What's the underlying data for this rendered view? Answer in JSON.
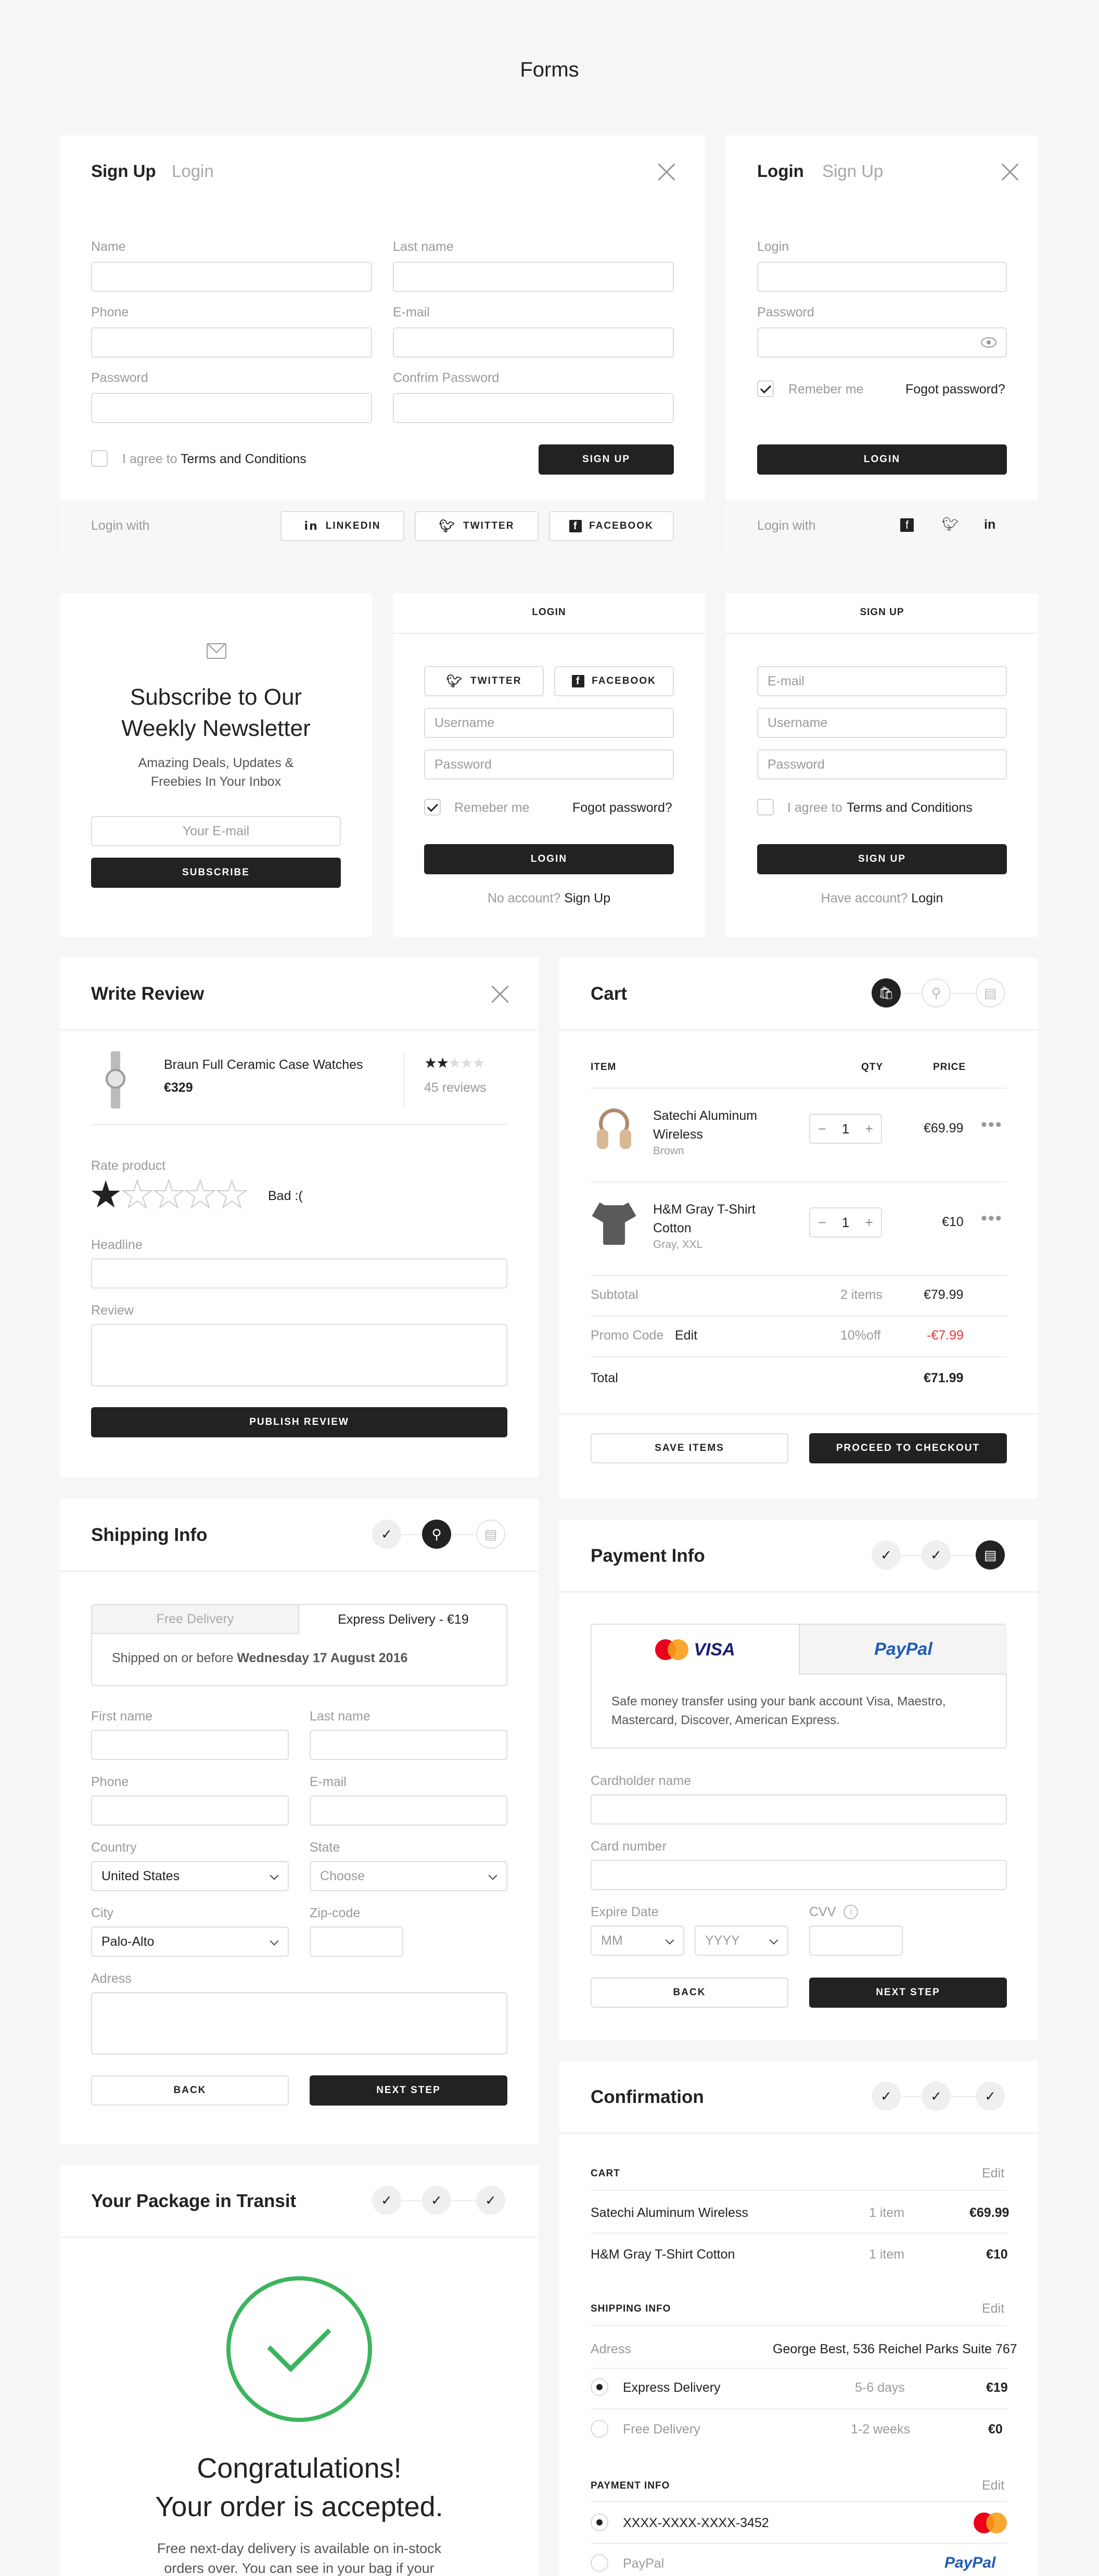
{
  "page_title": "Forms",
  "signup_card": {
    "tab_active": "Sign Up",
    "tab_inactive": "Login",
    "name_label": "Name",
    "lastname_label": "Last name",
    "phone_label": "Phone",
    "email_label": "E-mail",
    "password_label": "Password",
    "confirm_label": "Confrim Password",
    "agree_prefix": "I agree to",
    "terms": "Terms and Conditions",
    "submit": "SIGN UP",
    "login_with": "Login with",
    "linkedin": "LINKEDIN",
    "twitter": "TWITTER",
    "facebook": "FACEBOOK"
  },
  "login_card": {
    "tab_active": "Login",
    "tab_inactive": "Sign Up",
    "login_label": "Login",
    "password_label": "Password",
    "remember": "Remeber me",
    "forgot": "Fogot password?",
    "submit": "LOGIN",
    "login_with": "Login with"
  },
  "newsletter": {
    "title_line1": "Subscribe to Our",
    "title_line2": "Weekly Newsletter",
    "sub_line1": "Amazing Deals, Updates &",
    "sub_line2": "Freebies In Your Inbox",
    "email_placeholder": "Your E-mail",
    "submit": "SUBSCRIBE"
  },
  "login_social": {
    "title": "LOGIN",
    "twitter": "TWITTER",
    "facebook": "FACEBOOK",
    "username_placeholder": "Username",
    "password_placeholder": "Password",
    "remember": "Remeber me",
    "forgot": "Fogot password?",
    "submit": "LOGIN",
    "no_account": "No account?",
    "signup_link": "Sign Up"
  },
  "signup_simple": {
    "title": "SIGN UP",
    "email_placeholder": "E-mail",
    "username_placeholder": "Username",
    "password_placeholder": "Password",
    "agree_prefix": "I agree to",
    "terms": "Terms and Conditions",
    "submit": "SIGN UP",
    "have_account": "Have account?",
    "login_link": "Login"
  },
  "review": {
    "title": "Write Review",
    "product": "Braun Full Ceramic Case Watches",
    "price": "€329",
    "reviews": "45 reviews",
    "rating": 2,
    "rate_label": "Rate product",
    "rate_text": "Bad :(",
    "headline_label": "Headline",
    "review_label": "Review",
    "submit": "PUBLISH REVIEW"
  },
  "cart": {
    "title": "Cart",
    "col_item": "ITEM",
    "col_qty": "QTY",
    "col_price": "PRICE",
    "items": [
      {
        "name_line1": "Satechi Aluminum",
        "name_line2": "Wireless",
        "variant": "Brown",
        "qty": "1",
        "price": "€69.99"
      },
      {
        "name_line1": "H&M Gray T-Shirt",
        "name_line2": "Cotton",
        "variant": "Gray, XXL",
        "qty": "1",
        "price": "€10"
      }
    ],
    "subtotal_label": "Subtotal",
    "subtotal_count": "2 items",
    "subtotal": "€79.99",
    "promo_label": "Promo Code",
    "promo_edit": "Edit",
    "promo_off": "10%off",
    "promo_value": "-€7.99",
    "total_label": "Total",
    "total": "€71.99",
    "save": "SAVE ITEMS",
    "checkout": "PROCEED TO CHECKOUT",
    "accent_red": "#e53935"
  },
  "shipping": {
    "title": "Shipping Info",
    "free": "Free Delivery",
    "express": "Express Delivery - €19",
    "shipped_prefix": "Shipped on or before",
    "shipped_date": "Wednesday 17 August 2016",
    "first_label": "First name",
    "last_label": "Last name",
    "phone_label": "Phone",
    "email_label": "E-mail",
    "country_label": "Country",
    "country": "United States",
    "state_label": "State",
    "state": "Choose",
    "city_label": "City",
    "city": "Palo-Alto",
    "zip_label": "Zip-code",
    "address_label": "Adress",
    "back": "BACK",
    "next": "NEXT STEP"
  },
  "payment": {
    "title": "Payment Info",
    "visa": "VISA",
    "paypal": "PayPal",
    "desc_line1": "Safe money transfer using your bank account Visa, Maestro,",
    "desc_line2": "Mastercard, Discover, American Express.",
    "holder_label": "Cardholder name",
    "number_label": "Card number",
    "expire_label": "Expire Date",
    "mm": "MM",
    "yyyy": "YYYY",
    "cvv_label": "CVV",
    "back": "BACK",
    "next": "NEXT STEP"
  },
  "transit": {
    "title": "Your Package in Transit",
    "congrats_line1": "Congratulations!",
    "congrats_line2": "Your order is accepted.",
    "desc_line1": "Free next-day delivery is available on in-stock",
    "desc_line2": "orders over. You can see in your bag if your",
    "accent_green": "#3cb55e"
  },
  "confirmation": {
    "title": "Confirmation",
    "cart_caption": "CART",
    "edit": "Edit",
    "cart_items": [
      {
        "name": "Satechi Aluminum Wireless",
        "count": "1 item",
        "price": "€69.99"
      },
      {
        "name": "H&M Gray T-Shirt Cotton",
        "count": "1 item",
        "price": "€10"
      }
    ],
    "shipping_caption": "SHIPPING INFO",
    "address_label": "Adress",
    "address": "George Best, 536 Reichel Parks Suite 767",
    "delivery": [
      {
        "name": "Express Delivery",
        "time": "5-6 days",
        "price": "€19"
      },
      {
        "name": "Free Delivery",
        "time": "1-2 weeks",
        "price": "€0"
      }
    ],
    "payment_caption": "PAYMENT INFO",
    "card_number": "XXXX-XXXX-XXXX-3452",
    "paypal": "PayPal"
  }
}
